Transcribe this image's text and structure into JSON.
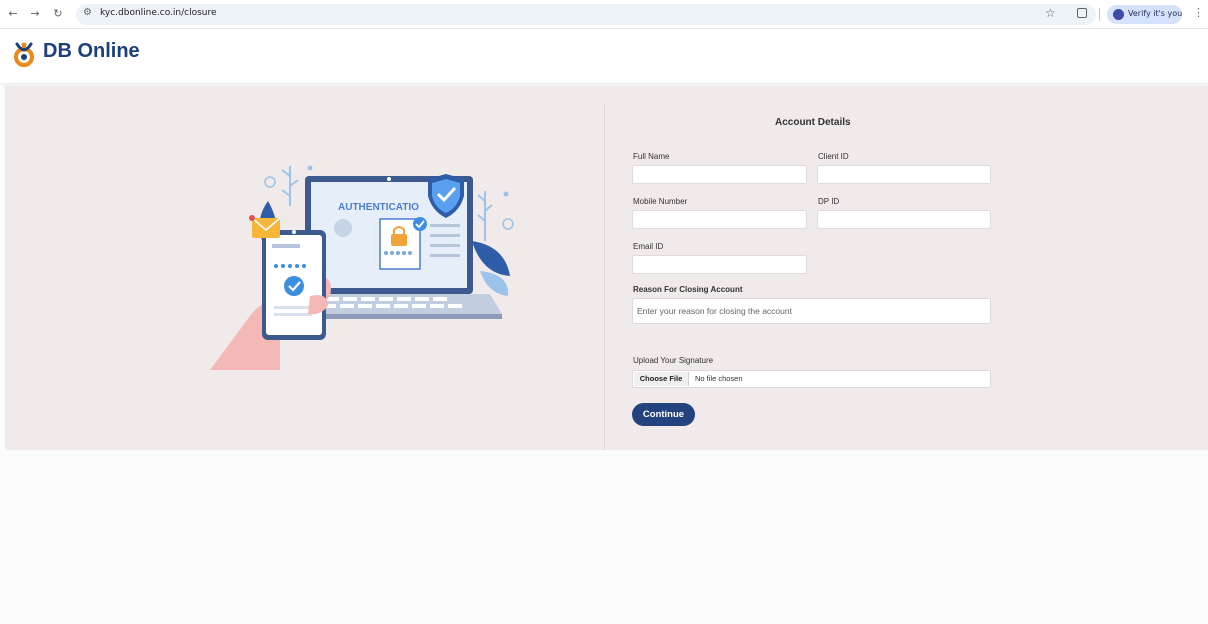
{
  "browser": {
    "url": "kyc.dbonline.co.in/closure",
    "verify_label": "Verify it's you"
  },
  "site": {
    "logo_text": "DB Online"
  },
  "illustration": {
    "screen_text": "AUTHENTICATIO"
  },
  "form": {
    "title": "Account Details",
    "full_name_label": "Full Name",
    "client_id_label": "Client ID",
    "mobile_label": "Mobile Number",
    "dp_id_label": "DP ID",
    "email_label": "Email ID",
    "reason_label": "Reason For Closing Account",
    "reason_placeholder": "Enter your reason for closing the account",
    "signature_label": "Upload Your Signature",
    "choose_file_label": "Choose File",
    "file_status": "No file chosen",
    "continue_label": "Continue"
  },
  "colors": {
    "brand": "#1d3f7a",
    "button": "#23427e",
    "panel_bg": "#f1eaea"
  }
}
